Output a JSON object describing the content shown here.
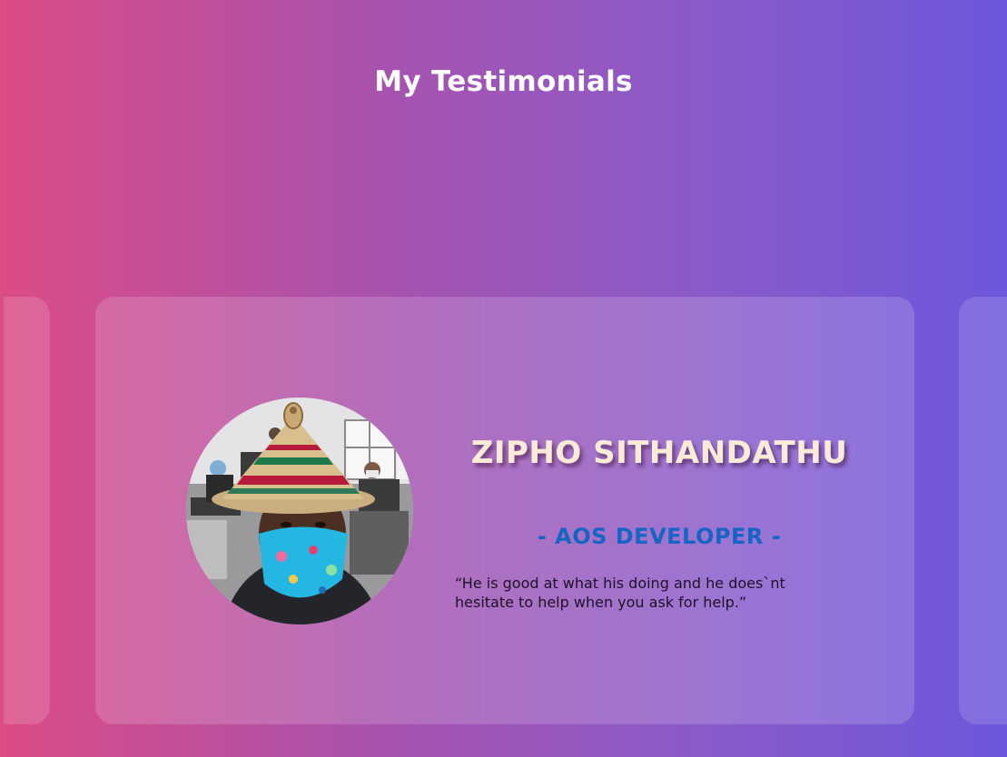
{
  "header": {
    "title": "My Testimonials"
  },
  "testimonial": {
    "name": "ZIPHO SITHANDATHU",
    "role": "- AOS DEVELOPER -",
    "quote": "“He is good at what his doing and he does`nt hesitate to help when you ask for help.”",
    "avatar_alt": "Person wearing a woven conical hat and a blue patterned face mask in a classroom"
  },
  "colors": {
    "gradient_start": "#dc4c86",
    "gradient_end": "#6d57dc",
    "name_color": "#fcebd6",
    "role_color": "#1664c4"
  }
}
